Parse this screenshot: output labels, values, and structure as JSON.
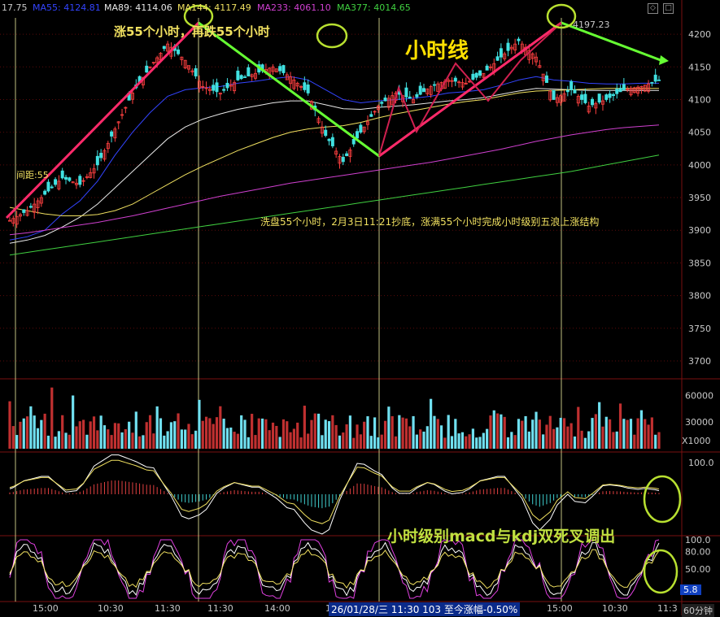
{
  "header": {
    "left_value": "17.75",
    "ma": [
      {
        "label": "MA55: 4124.81",
        "color": "#3344ff"
      },
      {
        "label": "MA89: 4114.06",
        "color": "#e8e8e8"
      },
      {
        "label": "MA144: 4117.49",
        "color": "#f0e060"
      },
      {
        "label": "MA233: 4061.10",
        "color": "#d040d0"
      },
      {
        "label": "MA377: 4014.65",
        "color": "#40d040"
      }
    ],
    "controls": [
      "◇",
      "□"
    ]
  },
  "annotations": {
    "rise55": "涨55个小时，再跌55个小时",
    "hourline": "小时线",
    "spacing": "间距:55",
    "wash": "洗盘55个小时，2月3日11:21抄底，涨满55个小时完成小时级别五浪上涨结构",
    "peak": "4197.23",
    "macd_kdj": "小时级别macd与kdj双死叉调出"
  },
  "status": {
    "info": "26/01/28/三  11:30  103  至今涨幅-0.50%",
    "period": "60分钟",
    "kdj_value": "5.8"
  },
  "chart_data": [
    {
      "type": "candlestick",
      "yaxis_ticks": [
        4200,
        4150,
        4100,
        4050,
        4000,
        3950,
        3900,
        3850,
        3800,
        3750,
        3700
      ],
      "ylim": [
        3685,
        4225
      ],
      "xticks": [
        "15:00",
        "10:30",
        "11:30",
        "11:30",
        "14:00",
        "11:30",
        "14:00",
        "15:00",
        "10:30",
        "11:3"
      ],
      "close": [
        3915,
        3930,
        3955,
        3980,
        3970,
        4000,
        4055,
        4110,
        4150,
        4185,
        4160,
        4120,
        4110,
        4130,
        4140,
        4150,
        4135,
        4110,
        4045,
        4005,
        4050,
        4090,
        4110,
        4100,
        4120,
        4130,
        4125,
        4140,
        4165,
        4190,
        4165,
        4100,
        4115,
        4090,
        4100,
        4115,
        4120,
        4130
      ],
      "high_mark": 4197.23,
      "ma_lines": [
        {
          "name": "MA55",
          "color": "#3344ff",
          "values": [
            3885,
            3890,
            3900,
            3925,
            3945,
            3975,
            4015,
            4050,
            4080,
            4105,
            4115,
            4118,
            4120,
            4125,
            4128,
            4132,
            4135,
            4130,
            4115,
            4100,
            4095,
            4098,
            4100,
            4102,
            4105,
            4110,
            4112,
            4115,
            4122,
            4130,
            4135,
            4130,
            4128,
            4125,
            4124,
            4124,
            4125,
            4125
          ]
        },
        {
          "name": "MA89",
          "color": "#e8e8e8",
          "values": [
            3880,
            3885,
            3892,
            3905,
            3920,
            3940,
            3965,
            3990,
            4015,
            4040,
            4058,
            4070,
            4078,
            4085,
            4090,
            4095,
            4098,
            4098,
            4092,
            4086,
            4085,
            4088,
            4090,
            4092,
            4095,
            4098,
            4100,
            4103,
            4108,
            4113,
            4117,
            4116,
            4115,
            4114,
            4114,
            4114,
            4114,
            4114
          ]
        },
        {
          "name": "MA144",
          "color": "#f0e060",
          "values": [
            3935,
            3930,
            3925,
            3922,
            3922,
            3924,
            3930,
            3940,
            3955,
            3970,
            3985,
            3998,
            4010,
            4022,
            4032,
            4042,
            4050,
            4055,
            4058,
            4060,
            4065,
            4072,
            4078,
            4083,
            4088,
            4093,
            4097,
            4100,
            4105,
            4110,
            4113,
            4114,
            4115,
            4116,
            4117,
            4117,
            4117,
            4117
          ]
        },
        {
          "name": "MA233",
          "color": "#d040d0",
          "values": [
            3893,
            3896,
            3900,
            3904,
            3908,
            3912,
            3917,
            3922,
            3928,
            3934,
            3940,
            3946,
            3952,
            3957,
            3962,
            3967,
            3972,
            3976,
            3980,
            3984,
            3988,
            3992,
            3996,
            4000,
            4004,
            4009,
            4014,
            4019,
            4024,
            4030,
            4036,
            4041,
            4046,
            4050,
            4054,
            4057,
            4059,
            4061
          ]
        },
        {
          "name": "MA377",
          "color": "#40d040",
          "values": [
            3862,
            3866,
            3870,
            3874,
            3878,
            3882,
            3886,
            3890,
            3894,
            3898,
            3902,
            3906,
            3910,
            3914,
            3918,
            3922,
            3926,
            3930,
            3934,
            3938,
            3942,
            3946,
            3950,
            3954,
            3958,
            3962,
            3966,
            3970,
            3974,
            3978,
            3982,
            3986,
            3990,
            3995,
            4000,
            4005,
            4010,
            4015
          ]
        }
      ]
    },
    {
      "type": "bar",
      "name": "volume",
      "yaxis_ticks": [
        60000,
        30000
      ],
      "unit": "X1000",
      "ylim": [
        0,
        75000
      ]
    },
    {
      "type": "line",
      "name": "macd",
      "yaxis_ticks": [
        100.0
      ]
    },
    {
      "type": "line",
      "name": "kdj",
      "yaxis_ticks": [
        100.0,
        80.0,
        50.0
      ]
    }
  ]
}
